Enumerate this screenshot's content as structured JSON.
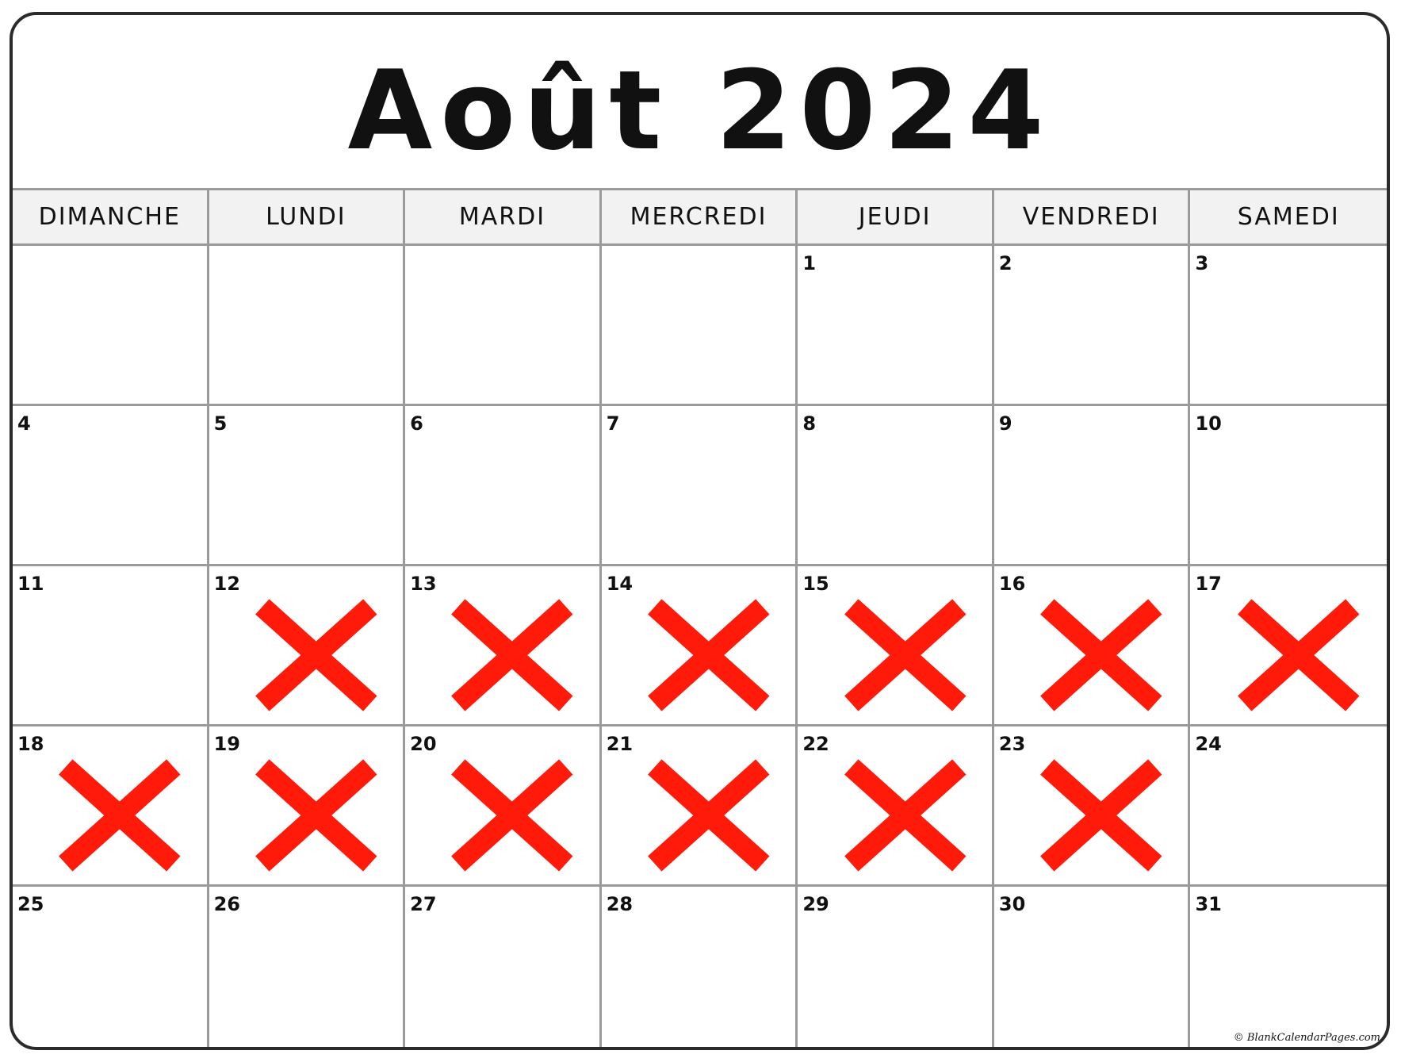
{
  "title": "Août 2024",
  "weekdays": [
    "DIMANCHE",
    "LUNDI",
    "MARDI",
    "MERCREDI",
    "JEUDI",
    "VENDREDI",
    "SAMEDI"
  ],
  "weeks": [
    [
      {
        "day": ""
      },
      {
        "day": ""
      },
      {
        "day": ""
      },
      {
        "day": ""
      },
      {
        "day": "1"
      },
      {
        "day": "2"
      },
      {
        "day": "3"
      }
    ],
    [
      {
        "day": "4"
      },
      {
        "day": "5"
      },
      {
        "day": "6"
      },
      {
        "day": "7"
      },
      {
        "day": "8"
      },
      {
        "day": "9"
      },
      {
        "day": "10"
      }
    ],
    [
      {
        "day": "11"
      },
      {
        "day": "12",
        "crossed": true
      },
      {
        "day": "13",
        "crossed": true
      },
      {
        "day": "14",
        "crossed": true
      },
      {
        "day": "15",
        "crossed": true
      },
      {
        "day": "16",
        "crossed": true
      },
      {
        "day": "17",
        "crossed": true
      }
    ],
    [
      {
        "day": "18",
        "crossed": true
      },
      {
        "day": "19",
        "crossed": true
      },
      {
        "day": "20",
        "crossed": true
      },
      {
        "day": "21",
        "crossed": true
      },
      {
        "day": "22",
        "crossed": true
      },
      {
        "day": "23",
        "crossed": true
      },
      {
        "day": "24"
      }
    ],
    [
      {
        "day": "25"
      },
      {
        "day": "26"
      },
      {
        "day": "27"
      },
      {
        "day": "28"
      },
      {
        "day": "29"
      },
      {
        "day": "30"
      },
      {
        "day": "31"
      }
    ]
  ],
  "cross_color": "#ff1a0a",
  "credit": "© BlankCalendarPages.com"
}
